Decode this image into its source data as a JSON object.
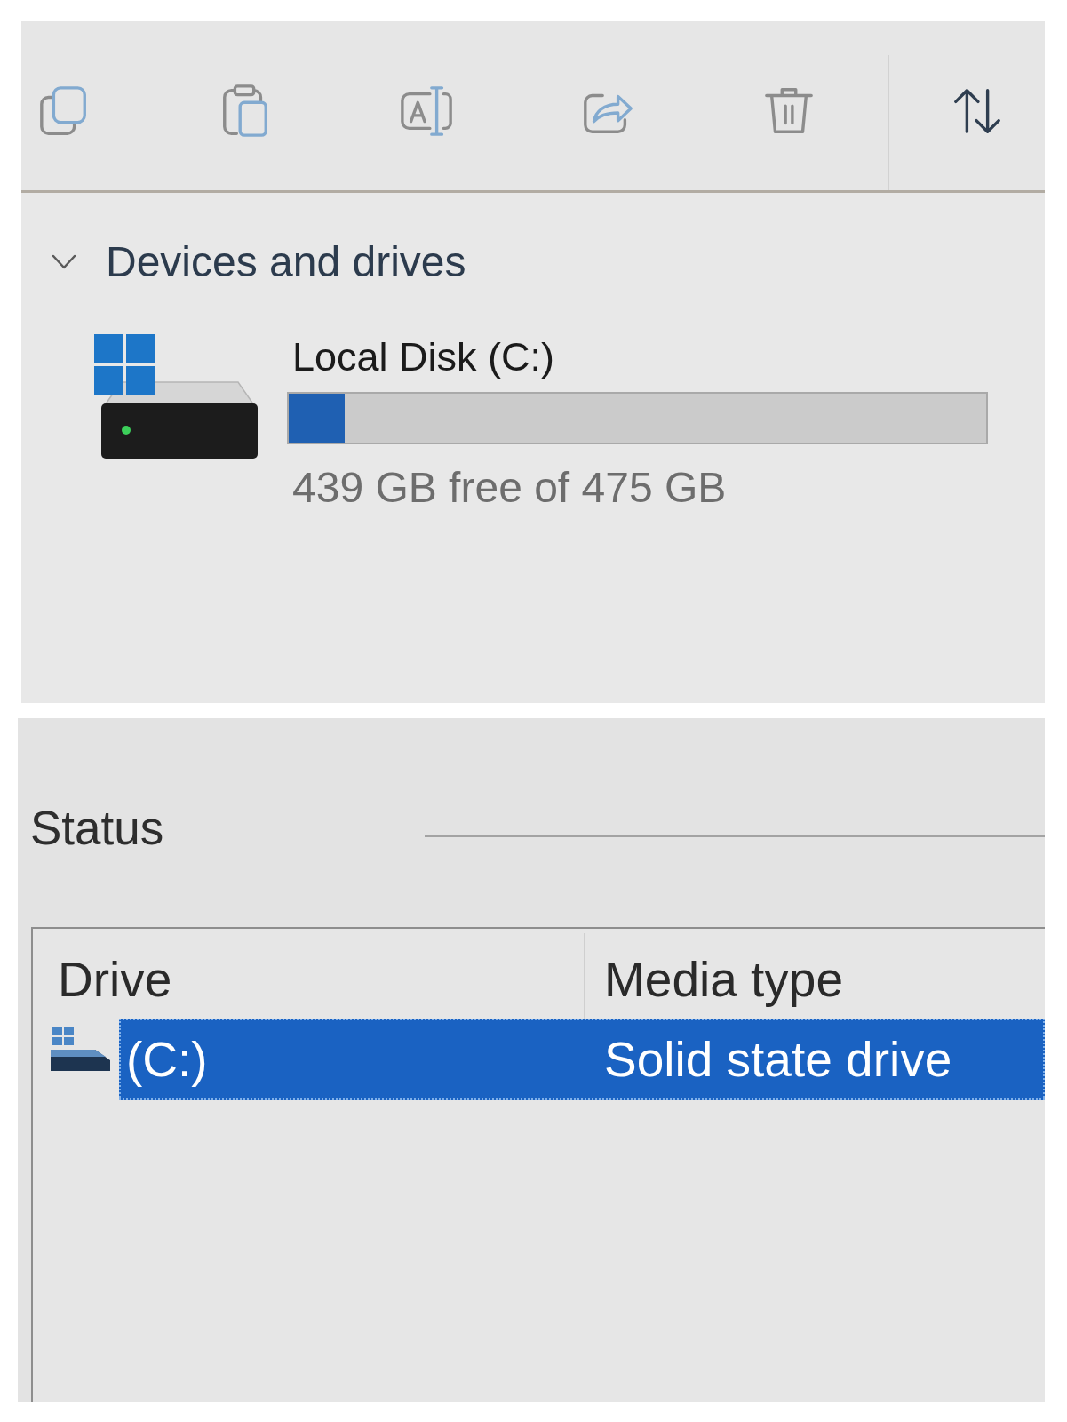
{
  "explorer": {
    "toolbar": {
      "groups": [
        {
          "buttons": [
            {
              "kind": "copy",
              "disabled": true
            },
            {
              "kind": "paste",
              "disabled": true
            },
            {
              "kind": "rename",
              "disabled": true
            },
            {
              "kind": "share",
              "disabled": true
            },
            {
              "kind": "delete",
              "disabled": true
            }
          ]
        },
        {
          "buttons": [
            {
              "kind": "sort",
              "disabled": false
            }
          ]
        }
      ]
    },
    "section": {
      "title": "Devices and drives",
      "expanded": true,
      "drives": [
        {
          "name": "Local Disk (C:)",
          "level": 0.08,
          "space": "439 GB free of 475 GB"
        }
      ]
    }
  },
  "status_dialog": {
    "label": "Status",
    "table": {
      "columns": [
        "Drive",
        "Media type"
      ],
      "rows": [
        {
          "selected": true,
          "cells": [
            "(C:)",
            "Solid state drive"
          ]
        }
      ]
    }
  }
}
